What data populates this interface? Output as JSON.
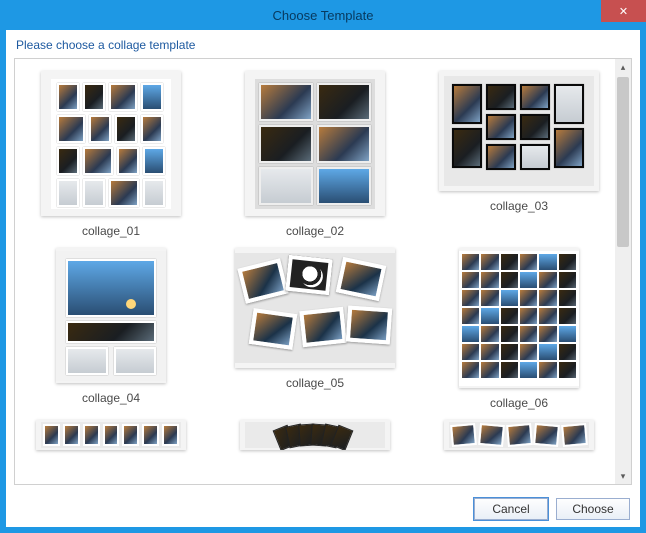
{
  "window": {
    "title": "Choose Template",
    "close_label": "✕"
  },
  "instruction": "Please choose a collage template",
  "templates": [
    {
      "id": "collage_01",
      "label": "collage_01"
    },
    {
      "id": "collage_02",
      "label": "collage_02"
    },
    {
      "id": "collage_03",
      "label": "collage_03"
    },
    {
      "id": "collage_04",
      "label": "collage_04"
    },
    {
      "id": "collage_05",
      "label": "collage_05"
    },
    {
      "id": "collage_06",
      "label": "collage_06"
    }
  ],
  "buttons": {
    "cancel": "Cancel",
    "choose": "Choose"
  }
}
